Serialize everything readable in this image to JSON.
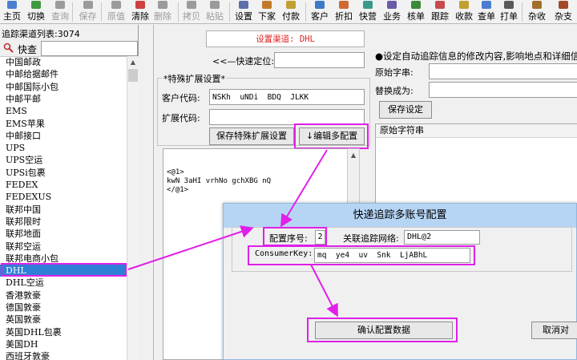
{
  "toolbar": {
    "buttons": [
      {
        "label": "主页",
        "icon": "home-icon",
        "color": "#4a7fd0",
        "enabled": true
      },
      {
        "label": "切换",
        "icon": "switch-icon",
        "color": "#3f9a3f",
        "enabled": true
      },
      {
        "label": "查询",
        "icon": "search-icon",
        "color": "#9b9b9b",
        "enabled": false
      },
      {
        "label": "保存",
        "icon": "save-icon",
        "color": "#9b9b9b",
        "enabled": false
      },
      {
        "label": "原值",
        "icon": "undo-icon",
        "color": "#9b9b9b",
        "enabled": false
      },
      {
        "label": "清除",
        "icon": "clear-icon",
        "color": "#d04040",
        "enabled": true
      },
      {
        "label": "删除",
        "icon": "delete-icon",
        "color": "#9b9b9b",
        "enabled": false
      },
      {
        "label": "拷贝",
        "icon": "copy-icon",
        "color": "#9b9b9b",
        "enabled": false
      },
      {
        "label": "粘贴",
        "icon": "paste-icon",
        "color": "#9b9b9b",
        "enabled": false
      },
      {
        "label": "设置",
        "icon": "settings-icon",
        "color": "#5c6fa8",
        "enabled": true
      },
      {
        "label": "下家",
        "icon": "next-party-icon",
        "color": "#c27a2a",
        "enabled": true
      },
      {
        "label": "付款",
        "icon": "payment-icon",
        "color": "#c0a030",
        "enabled": true
      },
      {
        "label": "客户",
        "icon": "customer-icon",
        "color": "#3a7ac8",
        "enabled": true
      },
      {
        "label": "折扣",
        "icon": "discount-icon",
        "color": "#d06a30",
        "enabled": true
      },
      {
        "label": "快营",
        "icon": "express-icon",
        "color": "#3a9a8a",
        "enabled": true
      },
      {
        "label": "业务",
        "icon": "business-icon",
        "color": "#6a5aa8",
        "enabled": true
      },
      {
        "label": "核单",
        "icon": "check-order-icon",
        "color": "#3a8a3a",
        "enabled": true
      },
      {
        "label": "跟踪",
        "icon": "tracking-icon",
        "color": "#c84a4a",
        "enabled": true
      },
      {
        "label": "收款",
        "icon": "receipt-icon",
        "color": "#c0a030",
        "enabled": true
      },
      {
        "label": "查单",
        "icon": "query-order-icon",
        "color": "#4a7fd0",
        "enabled": true
      },
      {
        "label": "打单",
        "icon": "print-icon",
        "color": "#5a5a5a",
        "enabled": true
      },
      {
        "label": "杂收",
        "icon": "misc-income-icon",
        "color": "#a0702a",
        "enabled": true
      },
      {
        "label": "杂支",
        "icon": "misc-expense-icon",
        "color": "#a04a2a",
        "enabled": true
      }
    ]
  },
  "left_panel": {
    "count_label": "追踪渠道列表:3074",
    "search_label": "快查",
    "search_value": "",
    "items": [
      "中国邮政",
      "中邮给据邮件",
      "中邮国际小包",
      "中邮平邮",
      "EMS",
      "EMS苹果",
      "中邮接口",
      "UPS",
      "UPS空运",
      "UPSi包裹",
      "FEDEX",
      "FEDEXUS",
      "联邦中国",
      "联邦限时",
      "联邦地面",
      "联邦空运",
      "联邦电商小包",
      "DHL",
      "DHL空运",
      "香港敦豪",
      "德国敦豪",
      "英国敦豪",
      "英国DHL包裹",
      "美国DH",
      "西班牙敦豪"
    ],
    "selected_index": 17
  },
  "right_panel": {
    "setting_channel": "设置渠道: DHL",
    "quick_locate_label": "<<—快速定位:",
    "quick_locate_value": "",
    "special_group_title": "*特殊扩展设置*",
    "customer_code_label": "客户代码:",
    "customer_code_value": "NSKh  uNDi  BDQ  JLKK",
    "ext_code_label": "扩展代码:",
    "ext_code_value": "",
    "save_special_button": "保存特殊扩展设置",
    "edit_multi_button": "↓编辑多配置",
    "config_text_line1": "<@1>",
    "config_text_line2": "kwN  3aHI  vrhNo  gchXBG  nQ",
    "config_text_line3": "</@1>",
    "auto_track_note": "●设定自动追踪信息的修改内容,影响地点和详细信",
    "original_string_label": "原始字串:",
    "original_string_value": "",
    "replace_label": "替换成为:",
    "replace_value": "",
    "save_setting_button": "保存设定",
    "original_string_column": "原始字符串"
  },
  "dialog": {
    "title": "快递追踪多账号配置",
    "config_index_label": "配置序号:",
    "config_index_value": "2",
    "linked_network_label": "关联追踪网络:",
    "linked_network_value": "DHL@2",
    "consumer_key_label": "ConsumerKey:",
    "consumer_key_value": "mq  ye4  uv  Snk  LjABhL",
    "confirm_button": "确认配置数据",
    "cancel_button": "取消对"
  },
  "colors": {
    "highlight": "#e020e8",
    "selection": "#2f7fd6",
    "dialog_title_bg": "#b6d5f5",
    "channel_text": "#e02020"
  }
}
